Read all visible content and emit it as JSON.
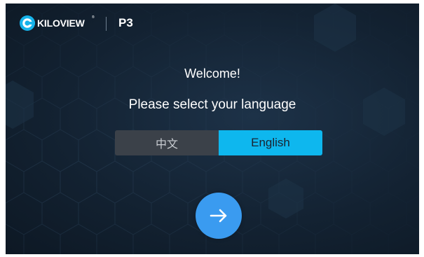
{
  "header": {
    "brand": "KILOVIEW",
    "brand_mark": "®",
    "model": "P3",
    "logo_icon": "kiloview-logo-icon"
  },
  "main": {
    "welcome": "Welcome!",
    "prompt": "Please select your language",
    "languages": [
      {
        "label": "中文",
        "selected": false
      },
      {
        "label": "English",
        "selected": true
      }
    ],
    "next_icon": "arrow-right-icon"
  },
  "colors": {
    "background": "#132232",
    "accent": "#0eb7ee",
    "next_button": "#3a9bf0",
    "unselected": "#3b4149",
    "text": "#ffffff"
  }
}
